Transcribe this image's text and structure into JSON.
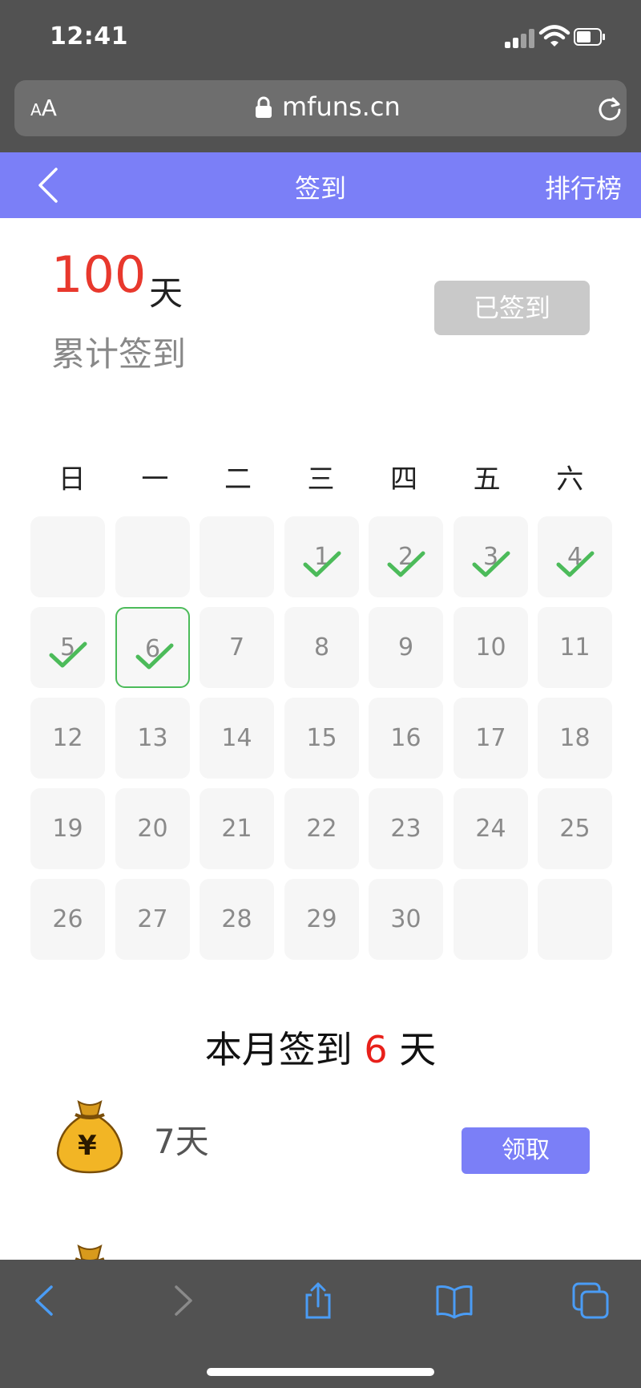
{
  "status_bar": {
    "time": "12:41"
  },
  "browser": {
    "text_size_label": "AA",
    "domain": "mfuns.cn"
  },
  "header": {
    "title": "签到",
    "ranking_label": "排行榜"
  },
  "summary": {
    "total_days": "100",
    "unit": "天",
    "label": "累计签到",
    "status_button": "已签到"
  },
  "calendar": {
    "weekdays": [
      "日",
      "一",
      "二",
      "三",
      "四",
      "五",
      "六"
    ],
    "leading_blank_cells": 3,
    "days_in_month": 30,
    "signed_days": [
      1,
      2,
      3,
      4,
      5,
      6
    ],
    "today": 6
  },
  "month_summary": {
    "prefix": "本月签到",
    "count": "6",
    "unit": "天"
  },
  "rewards": [
    {
      "label": "7天",
      "button": "领取",
      "icon": "money-bag-icon"
    }
  ],
  "colors": {
    "accent": "#7b7ff7",
    "highlight": "#e8382d",
    "check": "#4cbb5a",
    "disabled": "#c9c9c9"
  }
}
